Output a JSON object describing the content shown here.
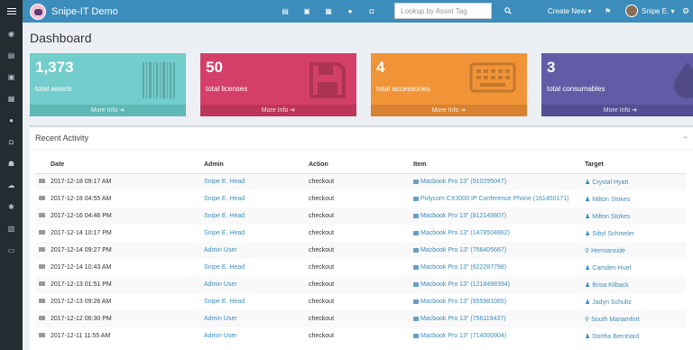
{
  "app": {
    "title": "Snipe-IT Demo"
  },
  "navbar": {
    "search_placeholder": "Lookup by Asset Tag",
    "create_new": "Create New ▾",
    "user_name": "Snipe E. ▾",
    "icons": [
      "assets-icon",
      "licenses-icon",
      "accessories-icon",
      "consumables-icon",
      "components-icon"
    ]
  },
  "page": {
    "title": "Dashboard"
  },
  "tiles": [
    {
      "value": "1,373",
      "label": "total assets",
      "more": "More Info ➔",
      "icon": "barcode-icon",
      "color": "#72cdcc"
    },
    {
      "value": "50",
      "label": "total licenses",
      "more": "More Info ➔",
      "icon": "floppy-disk-icon",
      "color": "#d43f69"
    },
    {
      "value": "4",
      "label": "total accessories",
      "more": "More Info ➔",
      "icon": "keyboard-icon",
      "color": "#f19438"
    },
    {
      "value": "3",
      "label": "total consumables",
      "more": "More Info ➔",
      "icon": "droplet-icon",
      "color": "#625ba5"
    }
  ],
  "activity": {
    "title": "Recent Activity",
    "collapse": "−",
    "columns": [
      "Date",
      "Admin",
      "Action",
      "Item",
      "Target"
    ],
    "rows": [
      {
        "date": "2017-12-18 09:17 AM",
        "admin": "Snipe E. Head",
        "action": "checkout",
        "item": "Macbook Pro 13\" (910295047)",
        "target": "Crystal Hyatt",
        "target_icon": "user-icon"
      },
      {
        "date": "2017-12-18 04:55 AM",
        "admin": "Snipe E. Head",
        "action": "checkout",
        "item": "Polycom CX3000 IP Conference Phone (161450171)",
        "target": "Milton Stokes",
        "target_icon": "user-icon"
      },
      {
        "date": "2017-12-16 04:46 PM",
        "admin": "Snipe E. Head",
        "action": "checkout",
        "item": "Macbook Pro 13\" (812149807)",
        "target": "Milton Stokes",
        "target_icon": "user-icon"
      },
      {
        "date": "2017-12-14 10:17 PM",
        "admin": "Snipe E. Head",
        "action": "checkout",
        "item": "Macbook Pro 13\" (1478504862)",
        "target": "Sibyl Schmeler",
        "target_icon": "user-icon"
      },
      {
        "date": "2017-12-14 09:27 PM",
        "admin": "Admin User",
        "action": "checkout",
        "item": "Macbook Pro 13\" (756405667)",
        "target": "Hermanside",
        "target_icon": "location-icon"
      },
      {
        "date": "2017-12-14 10:43 AM",
        "admin": "Snipe E. Head",
        "action": "checkout",
        "item": "Macbook Pro 13\" (622287798)",
        "target": "Camden Huel",
        "target_icon": "user-icon"
      },
      {
        "date": "2017-12-13 01:51 PM",
        "admin": "Admin User",
        "action": "checkout",
        "item": "Macbook Pro 13\" (1218498394)",
        "target": "Brisa Kilback",
        "target_icon": "user-icon"
      },
      {
        "date": "2017-12-13 09:26 AM",
        "admin": "Snipe E. Head",
        "action": "checkout",
        "item": "Macbook Pro 13\" (955981065)",
        "target": "Jadyn Schultz",
        "target_icon": "user-icon"
      },
      {
        "date": "2017-12-12 06:30 PM",
        "admin": "Admin User",
        "action": "checkout",
        "item": "Macbook Pro 13\" (756119437)",
        "target": "South Mariamfort",
        "target_icon": "location-icon"
      },
      {
        "date": "2017-12-11 11:55 AM",
        "admin": "Admin User",
        "action": "checkout",
        "item": "Macbook Pro 13\" (714000904)",
        "target": "Dortha Bernhard",
        "target_icon": "user-icon"
      }
    ]
  }
}
